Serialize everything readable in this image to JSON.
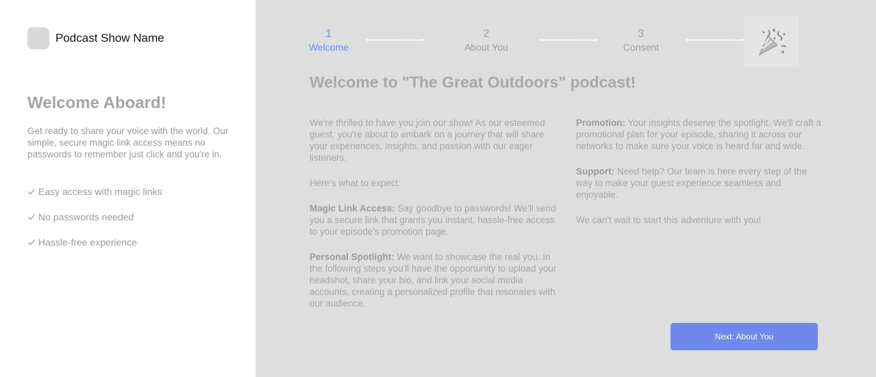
{
  "sidebar": {
    "brand_name": "Podcast Show Name",
    "title": "Welcome Aboard!",
    "description": "Get ready to share your voice with the world. Our simple, secure magic link access means no passwords to remember just click and you're in.",
    "features": [
      "Easy access with magic links",
      "No passwords needed",
      "Hassle-free experience"
    ]
  },
  "steps": [
    {
      "number": "1",
      "label": "Welcome",
      "active": true
    },
    {
      "number": "2",
      "label": "About You",
      "active": false
    },
    {
      "number": "3",
      "label": "Consent",
      "active": false
    }
  ],
  "final_step_icon": "party-popper-icon",
  "main": {
    "title": "Welcome to \"The Great Outdoors\" podcast!",
    "intro": "We're thrilled to have you join our show! As our esteemed guest, you're about to embark on a journey that will share your experiences, insights, and passion with our eager listeners.",
    "expect": "Here's what to expect:",
    "magic_heading": "Magic Link Access:",
    "magic_text": " Say goodbye to passwords! We'll send you a secure link that grants you instant, hassle-free access to your episode's promotion page.",
    "spotlight_heading": "Personal Spotlight:",
    "spotlight_text": " We want to showcase the real you. In the following steps you'll have the opportunity to upload your headshot, share your bio, and link your social media accounts, creating a personalized profile that resonates with our audience.",
    "promotion_heading": "Promotion:",
    "promotion_text": " Your insights deserve the spotlight. We'll craft a promotional plan for your episode, sharing it across our networks to make sure your voice is heard far and wide.",
    "support_heading": "Support:",
    "support_text": " Need help? Our team is here every step of the way to make your guest experience seamless and enjoyable.",
    "closing": "We can't wait to start this adventure with you!",
    "next_button": "Next: About You"
  },
  "colors": {
    "accent": "#6e88ec",
    "main_background": "#dedede",
    "sidebar_background": "#ffffff"
  }
}
